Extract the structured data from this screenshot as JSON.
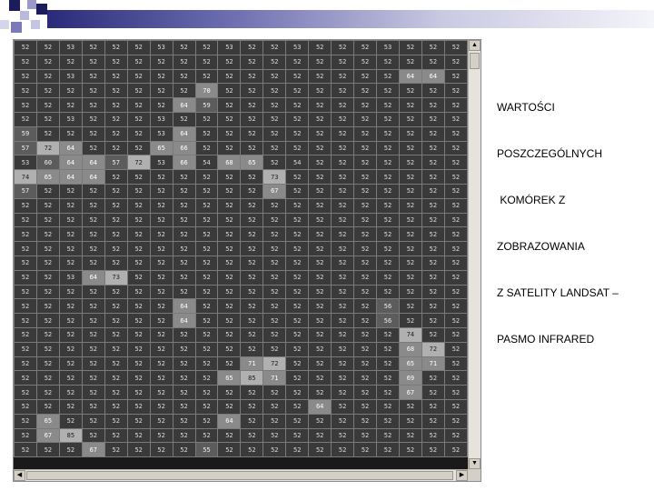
{
  "caption": {
    "lines": [
      "WARTOŚCI",
      "POSZCZEGÓLNYCH",
      " KOMÓREK Z",
      "ZOBRAZOWANIA",
      "Z SATELITY LANDSAT –",
      "PASMO INFRARED"
    ]
  },
  "grid": {
    "rows": [
      [
        "52",
        "52",
        "53",
        "52",
        "52",
        "52",
        "53",
        "52",
        "52",
        "53",
        "52",
        "52",
        "53",
        "52",
        "52",
        "52",
        "53",
        "52",
        "52",
        "52"
      ],
      [
        "52",
        "52",
        "52",
        "52",
        "52",
        "52",
        "52",
        "52",
        "52",
        "52",
        "52",
        "52",
        "52",
        "52",
        "52",
        "52",
        "52",
        "52",
        "52",
        "52"
      ],
      [
        "52",
        "52",
        "53",
        "52",
        "52",
        "52",
        "52",
        "52",
        "52",
        "52",
        "52",
        "52",
        "52",
        "52",
        "52",
        "52",
        "52",
        "64",
        "64",
        "52"
      ],
      [
        "52",
        "52",
        "52",
        "52",
        "52",
        "52",
        "52",
        "52",
        "70",
        "52",
        "52",
        "52",
        "52",
        "52",
        "52",
        "52",
        "52",
        "52",
        "52",
        "52"
      ],
      [
        "52",
        "52",
        "52",
        "52",
        "52",
        "52",
        "52",
        "64",
        "59",
        "52",
        "52",
        "52",
        "52",
        "52",
        "52",
        "52",
        "52",
        "52",
        "52",
        "52"
      ],
      [
        "52",
        "52",
        "53",
        "52",
        "52",
        "52",
        "53",
        "52",
        "52",
        "52",
        "52",
        "52",
        "52",
        "52",
        "52",
        "52",
        "52",
        "52",
        "52",
        "52"
      ],
      [
        "59",
        "52",
        "52",
        "52",
        "52",
        "52",
        "53",
        "64",
        "52",
        "52",
        "52",
        "52",
        "52",
        "52",
        "52",
        "52",
        "52",
        "52",
        "52",
        "52"
      ],
      [
        "57",
        "72",
        "64",
        "52",
        "52",
        "52",
        "65",
        "66",
        "52",
        "52",
        "52",
        "52",
        "52",
        "52",
        "52",
        "52",
        "52",
        "52",
        "52",
        "52"
      ],
      [
        "53",
        "60",
        "64",
        "64",
        "57",
        "72",
        "53",
        "66",
        "54",
        "68",
        "65",
        "52",
        "54",
        "52",
        "52",
        "52",
        "52",
        "52",
        "52",
        "52"
      ],
      [
        "74",
        "65",
        "64",
        "64",
        "52",
        "52",
        "52",
        "52",
        "52",
        "52",
        "52",
        "73",
        "52",
        "52",
        "52",
        "52",
        "52",
        "52",
        "52",
        "52"
      ],
      [
        "57",
        "52",
        "52",
        "52",
        "52",
        "52",
        "52",
        "52",
        "52",
        "52",
        "52",
        "67",
        "52",
        "52",
        "52",
        "52",
        "52",
        "52",
        "52",
        "52"
      ],
      [
        "52",
        "52",
        "52",
        "52",
        "52",
        "52",
        "52",
        "52",
        "52",
        "52",
        "52",
        "52",
        "52",
        "52",
        "52",
        "52",
        "52",
        "52",
        "52",
        "52"
      ],
      [
        "52",
        "52",
        "52",
        "52",
        "52",
        "52",
        "52",
        "52",
        "52",
        "52",
        "52",
        "52",
        "52",
        "52",
        "52",
        "52",
        "52",
        "52",
        "52",
        "52"
      ],
      [
        "52",
        "52",
        "52",
        "52",
        "52",
        "52",
        "52",
        "52",
        "52",
        "52",
        "52",
        "52",
        "52",
        "52",
        "52",
        "52",
        "52",
        "52",
        "52",
        "52"
      ],
      [
        "52",
        "52",
        "52",
        "52",
        "52",
        "52",
        "52",
        "52",
        "52",
        "52",
        "52",
        "52",
        "52",
        "52",
        "52",
        "52",
        "52",
        "52",
        "52",
        "52"
      ],
      [
        "52",
        "52",
        "52",
        "52",
        "52",
        "52",
        "52",
        "52",
        "52",
        "52",
        "52",
        "52",
        "52",
        "52",
        "52",
        "52",
        "52",
        "52",
        "52",
        "52"
      ],
      [
        "52",
        "52",
        "53",
        "64",
        "73",
        "52",
        "52",
        "52",
        "52",
        "52",
        "52",
        "52",
        "52",
        "52",
        "52",
        "52",
        "52",
        "52",
        "52",
        "52"
      ],
      [
        "52",
        "52",
        "52",
        "52",
        "52",
        "52",
        "52",
        "52",
        "52",
        "52",
        "52",
        "52",
        "52",
        "52",
        "52",
        "52",
        "52",
        "52",
        "52",
        "52"
      ],
      [
        "52",
        "52",
        "52",
        "52",
        "52",
        "52",
        "52",
        "64",
        "52",
        "52",
        "52",
        "52",
        "52",
        "52",
        "52",
        "52",
        "56",
        "52",
        "52",
        "52"
      ],
      [
        "52",
        "52",
        "52",
        "52",
        "52",
        "52",
        "52",
        "64",
        "52",
        "52",
        "52",
        "52",
        "52",
        "52",
        "52",
        "52",
        "56",
        "52",
        "52",
        "52"
      ],
      [
        "52",
        "52",
        "52",
        "52",
        "52",
        "52",
        "52",
        "52",
        "52",
        "52",
        "52",
        "52",
        "52",
        "52",
        "52",
        "52",
        "52",
        "74",
        "52",
        "52"
      ],
      [
        "52",
        "52",
        "52",
        "52",
        "52",
        "52",
        "52",
        "52",
        "52",
        "52",
        "52",
        "52",
        "52",
        "52",
        "52",
        "52",
        "52",
        "68",
        "72",
        "52"
      ],
      [
        "52",
        "52",
        "52",
        "52",
        "52",
        "52",
        "52",
        "52",
        "52",
        "52",
        "71",
        "72",
        "52",
        "52",
        "52",
        "52",
        "52",
        "65",
        "71",
        "52"
      ],
      [
        "52",
        "52",
        "52",
        "52",
        "52",
        "52",
        "52",
        "52",
        "52",
        "65",
        "85",
        "71",
        "52",
        "52",
        "52",
        "52",
        "52",
        "69",
        "52",
        "52"
      ],
      [
        "52",
        "52",
        "52",
        "52",
        "52",
        "52",
        "52",
        "52",
        "52",
        "52",
        "52",
        "52",
        "52",
        "52",
        "52",
        "52",
        "52",
        "67",
        "52",
        "52"
      ],
      [
        "52",
        "52",
        "52",
        "52",
        "52",
        "52",
        "52",
        "52",
        "52",
        "52",
        "52",
        "52",
        "52",
        "64",
        "52",
        "52",
        "52",
        "52",
        "52",
        "52"
      ],
      [
        "52",
        "65",
        "52",
        "52",
        "52",
        "52",
        "52",
        "52",
        "52",
        "64",
        "52",
        "52",
        "52",
        "52",
        "52",
        "52",
        "52",
        "52",
        "52",
        "52"
      ],
      [
        "52",
        "67",
        "85",
        "52",
        "52",
        "52",
        "52",
        "52",
        "52",
        "52",
        "52",
        "52",
        "52",
        "52",
        "52",
        "52",
        "52",
        "52",
        "52",
        "52"
      ],
      [
        "52",
        "52",
        "52",
        "67",
        "52",
        "52",
        "52",
        "52",
        "55",
        "52",
        "52",
        "52",
        "52",
        "52",
        "52",
        "52",
        "52",
        "52",
        "52",
        "52"
      ]
    ]
  }
}
